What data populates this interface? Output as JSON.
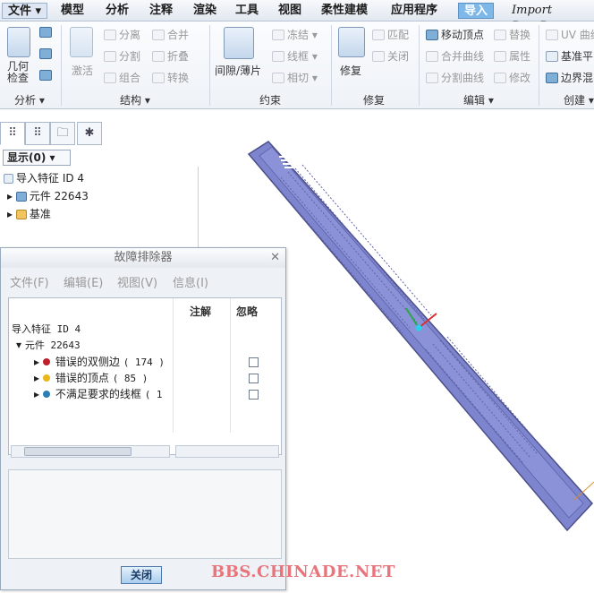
{
  "menubar": {
    "file": "文件",
    "tabs": [
      "模型",
      "分析",
      "注释",
      "渲染",
      "工具",
      "视图",
      "柔性建模",
      "应用程序"
    ],
    "active_tab": "导入",
    "import_title": "Import DataD"
  },
  "ribbon": {
    "groups": {
      "analysis": "分析",
      "structure": "结构",
      "constraint": "约束",
      "repair": "修复",
      "edit": "编辑",
      "create": "创建"
    },
    "buttons": {
      "geometry_check": "几何检查",
      "separate": "分离",
      "split": "分割",
      "combine": "组合",
      "activate": "激活",
      "merge": "合并",
      "fold": "折叠",
      "convert": "转换",
      "gap_thin": "间隙/薄片",
      "freeze": "冻结",
      "wireframe": "线框",
      "tangent": "相切",
      "repair": "修复",
      "match": "匹配",
      "close": "关闭",
      "move_vertex": "移动顶点",
      "merge_curves": "合并曲线",
      "split_curves": "分割曲线",
      "replace": "替换",
      "attribute": "属性",
      "modify": "修改",
      "uv_curve": "UV 曲线",
      "datum_plane": "基准平",
      "boundary_blend": "边界混"
    }
  },
  "left_panel": {
    "display_dropdown": "显示(0)",
    "tree": {
      "root": "导入特征 ID 4",
      "component": "元件 22643",
      "datum": "基准"
    }
  },
  "dialog": {
    "title": "故障排除器",
    "menu": [
      "文件(F)",
      "编辑(E)",
      "视图(V)",
      "信息(I)"
    ],
    "columns": {
      "annotate": "注解",
      "ignore": "忽略"
    },
    "rows": {
      "root": "导入特征 ID 4",
      "component": "元件 22643",
      "items": [
        {
          "label": "错误的双侧边",
          "count": "( 174 )",
          "color": "#c0202a"
        },
        {
          "label": "错误的顶点",
          "count": "( 85 )",
          "color": "#e8b81a"
        },
        {
          "label": "不满足要求的线框",
          "count": "( 1",
          "color": "#2b7fb8"
        }
      ]
    },
    "close_button": "关闭"
  },
  "watermark": "BBS.CHINADE.NET"
}
